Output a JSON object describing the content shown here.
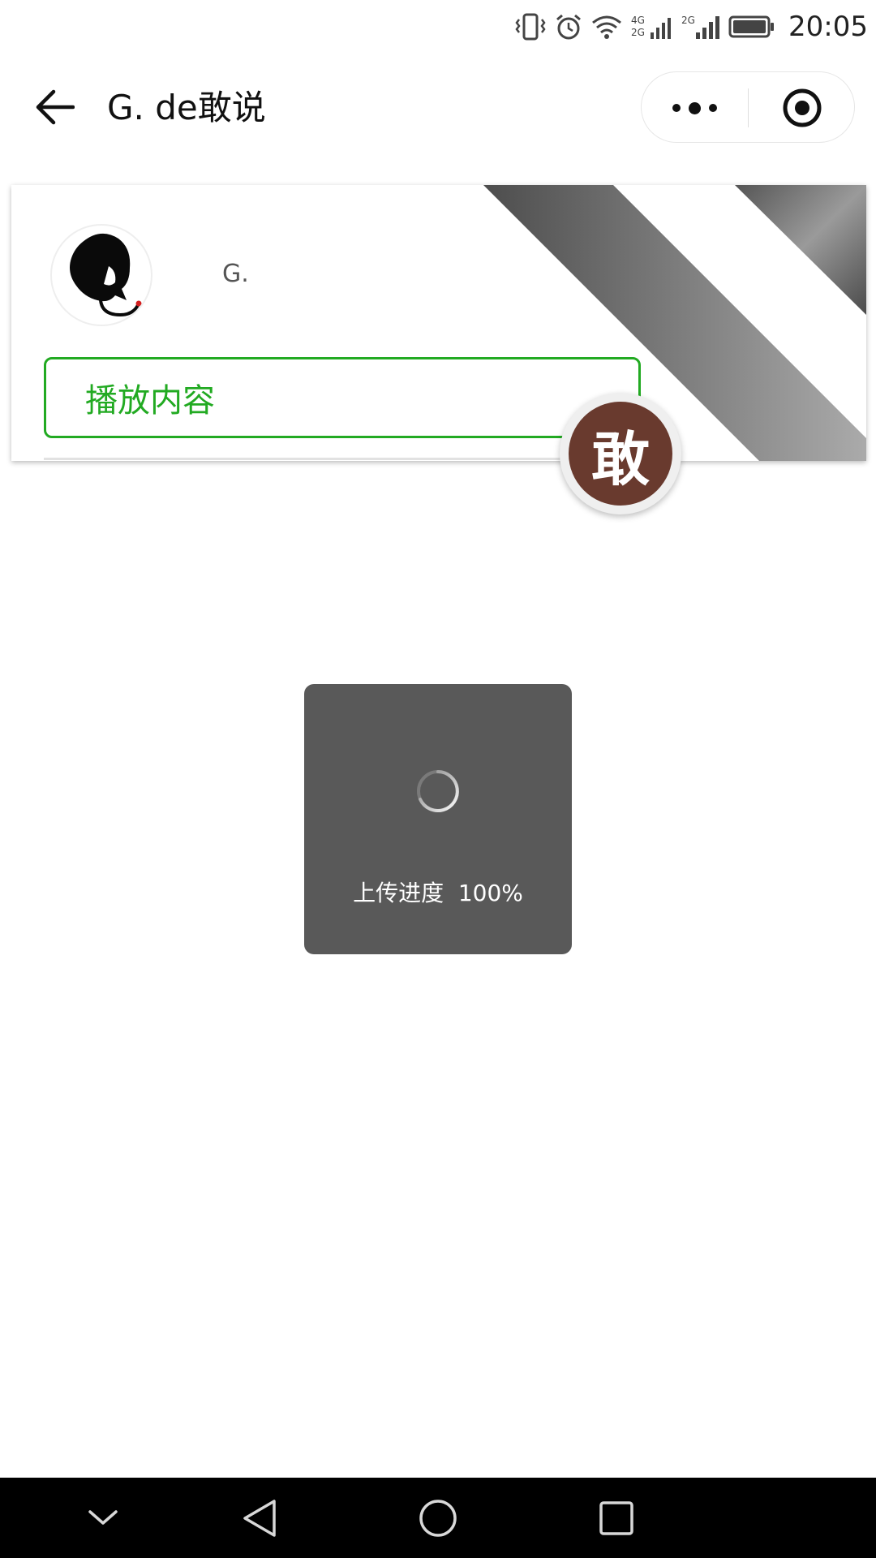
{
  "status_bar": {
    "time": "20:05",
    "network_labels": [
      "4G",
      "2G",
      "2G"
    ],
    "icons": [
      "vibrate-icon",
      "alarm-icon",
      "wifi-icon",
      "signal-4g-icon",
      "signal-2g-icon",
      "battery-icon"
    ]
  },
  "header": {
    "title": "G. de敢说",
    "back_icon": "arrow-left-icon",
    "more_icon": "more-dots-icon",
    "close_icon": "target-circle-icon"
  },
  "card": {
    "user_name": "G.",
    "play_button_label": "播放内容",
    "accent_color": "#22aa22"
  },
  "brand_badge": {
    "character": "敢",
    "color": "#693a2e"
  },
  "toast": {
    "label": "上传进度  100%",
    "progress_percent": 100
  },
  "nav_bar": {
    "icons": [
      "chevron-down-icon",
      "back-triangle-icon",
      "home-circle-icon",
      "recents-square-icon"
    ]
  }
}
